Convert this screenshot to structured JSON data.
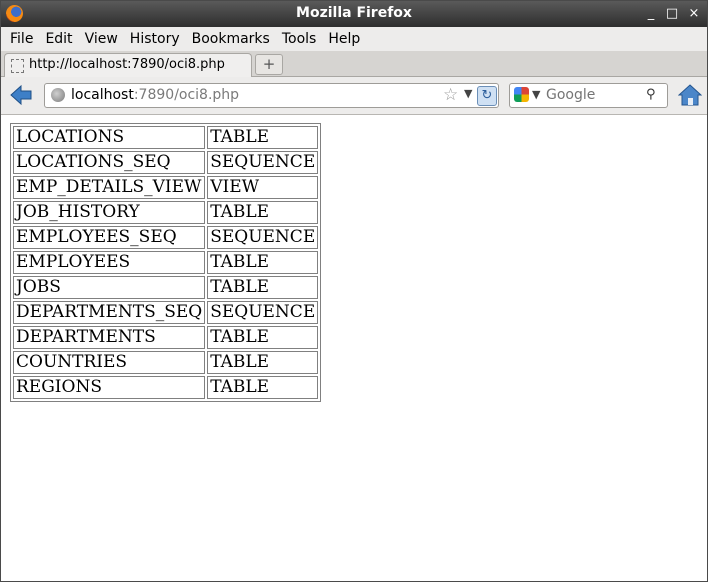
{
  "window": {
    "title": "Mozilla Firefox",
    "controls": [
      "_",
      "□",
      "×"
    ]
  },
  "menu": [
    "File",
    "Edit",
    "View",
    "History",
    "Bookmarks",
    "Tools",
    "Help"
  ],
  "tab": {
    "label": "http://localhost:7890/oci8.php",
    "new_tab_icon": "plus-icon"
  },
  "navbar": {
    "url_host": "localhost",
    "url_path": ":7890/oci8.php",
    "search_placeholder": "Google"
  },
  "objects": {
    "rows": [
      [
        "LOCATIONS",
        "TABLE"
      ],
      [
        "LOCATIONS_SEQ",
        "SEQUENCE"
      ],
      [
        "EMP_DETAILS_VIEW",
        "VIEW"
      ],
      [
        "JOB_HISTORY",
        "TABLE"
      ],
      [
        "EMPLOYEES_SEQ",
        "SEQUENCE"
      ],
      [
        "EMPLOYEES",
        "TABLE"
      ],
      [
        "JOBS",
        "TABLE"
      ],
      [
        "DEPARTMENTS_SEQ",
        "SEQUENCE"
      ],
      [
        "DEPARTMENTS",
        "TABLE"
      ],
      [
        "COUNTRIES",
        "TABLE"
      ],
      [
        "REGIONS",
        "TABLE"
      ]
    ]
  },
  "colors": {
    "titlebar": "#3b3b3b",
    "chrome": "#edeceb",
    "accent": "#2b5d9b"
  }
}
